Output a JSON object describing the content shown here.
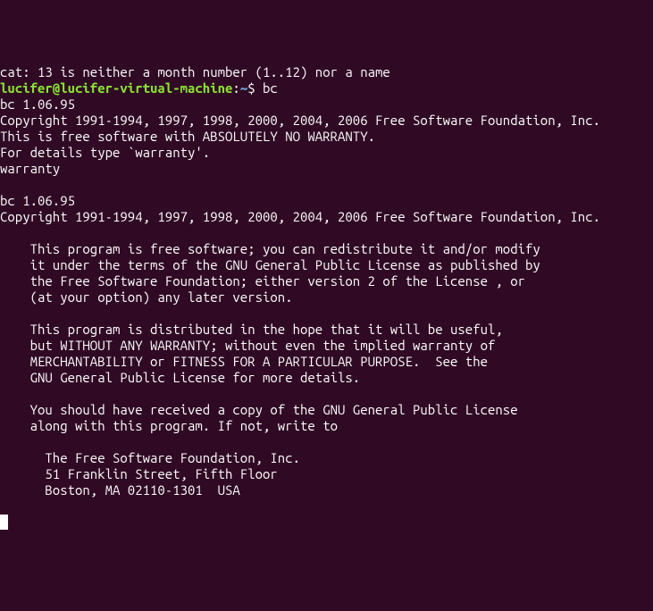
{
  "lines": {
    "truncated": "cat: 13 is neither a month number (1..12) nor a name",
    "prompt_user_host": "lucifer@lucifer-virtual-machine",
    "prompt_colon": ":",
    "prompt_path": "~",
    "prompt_dollar": "$ ",
    "command": "bc",
    "bc_version1": "bc 1.06.95",
    "copyright1": "Copyright 1991-1994, 1997, 1998, 2000, 2004, 2006 Free Software Foundation, Inc.",
    "free_software": "This is free software with ABSOLUTELY NO WARRANTY.",
    "details": "For details type `warranty'.",
    "warranty_cmd": "warranty",
    "blank1": "",
    "bc_version2": "bc 1.06.95",
    "copyright2": "Copyright 1991-1994, 1997, 1998, 2000, 2004, 2006 Free Software Foundation, Inc.",
    "blank2": "",
    "para1_l1": "    This program is free software; you can redistribute it and/or modify",
    "para1_l2": "    it under the terms of the GNU General Public License as published by",
    "para1_l3": "    the Free Software Foundation; either version 2 of the License , or",
    "para1_l4": "    (at your option) any later version.",
    "blank3": "",
    "para2_l1": "    This program is distributed in the hope that it will be useful,",
    "para2_l2": "    but WITHOUT ANY WARRANTY; without even the implied warranty of",
    "para2_l3": "    MERCHANTABILITY or FITNESS FOR A PARTICULAR PURPOSE.  See the",
    "para2_l4": "    GNU General Public License for more details.",
    "blank4": "",
    "para3_l1": "    You should have received a copy of the GNU General Public License",
    "para3_l2": "    along with this program. If not, write to",
    "blank5": "",
    "addr_l1": "      The Free Software Foundation, Inc.",
    "addr_l2": "      51 Franklin Street, Fifth Floor",
    "addr_l3": "      Boston, MA 02110-1301  USA",
    "blank6": ""
  }
}
